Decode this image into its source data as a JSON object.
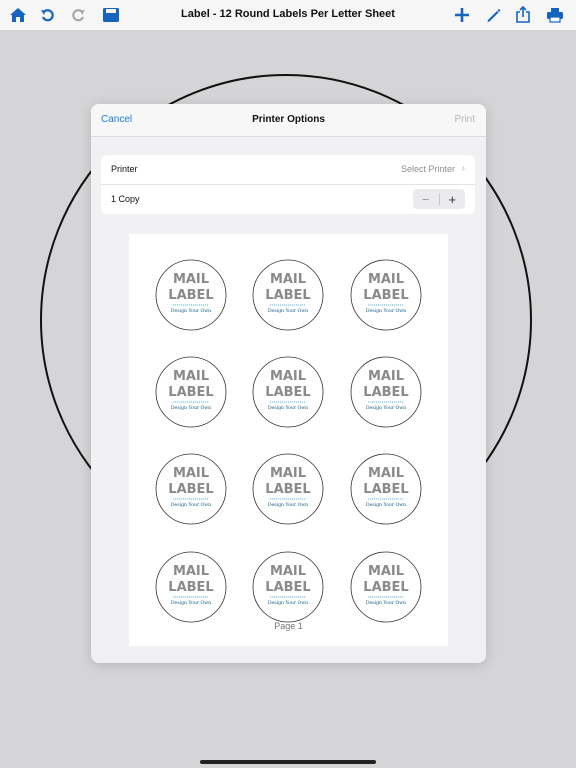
{
  "toolbar": {
    "title": "Label - 12 Round Labels Per Letter Sheet",
    "icons": [
      "home-icon",
      "undo-icon",
      "redo-icon",
      "save-icon",
      "add-icon",
      "pen-icon",
      "share-icon",
      "print-icon"
    ],
    "accent": "#1565c0"
  },
  "dialog": {
    "cancel": "Cancel",
    "title": "Printer Options",
    "print": "Print",
    "printer_label": "Printer",
    "printer_value": "Select Printer",
    "copies_label": "1 Copy",
    "minus": "−",
    "plus": "+",
    "link_color": "#1e7ce0"
  },
  "preview": {
    "page_label": "Page 1",
    "label_line1": "Mail",
    "label_line2": "Label",
    "label_tagline": "Design Your Own",
    "label_count": 12,
    "tagline_color": "#2a9cc8"
  }
}
